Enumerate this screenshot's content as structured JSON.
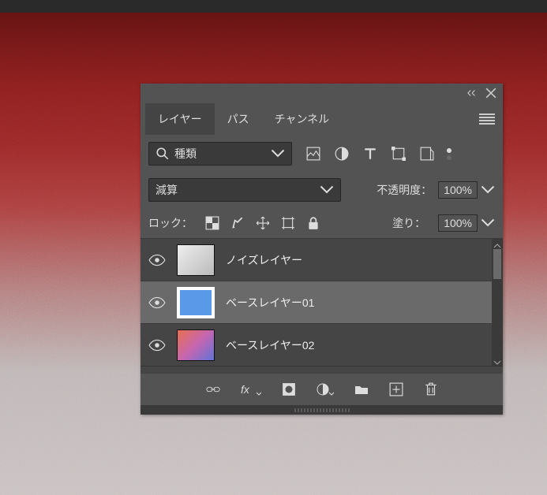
{
  "header": {
    "collapse_title": "collapse",
    "close_title": "close"
  },
  "tabs": [
    "レイヤー",
    "パス",
    "チャンネル"
  ],
  "tabs_active": 0,
  "filter": {
    "label": "種類"
  },
  "blend": {
    "mode": "減算",
    "opacity_label": "不透明度：",
    "opacity_value": "100%"
  },
  "lock": {
    "label": "ロック：",
    "fill_label": "塗り：",
    "fill_value": "100%"
  },
  "layers": [
    {
      "name": "ノイズレイヤー",
      "thumb": "noise",
      "selected": false
    },
    {
      "name": "ベースレイヤー01",
      "thumb": "blue",
      "selected": true
    },
    {
      "name": "ベースレイヤー02",
      "thumb": "grad",
      "selected": false
    }
  ]
}
